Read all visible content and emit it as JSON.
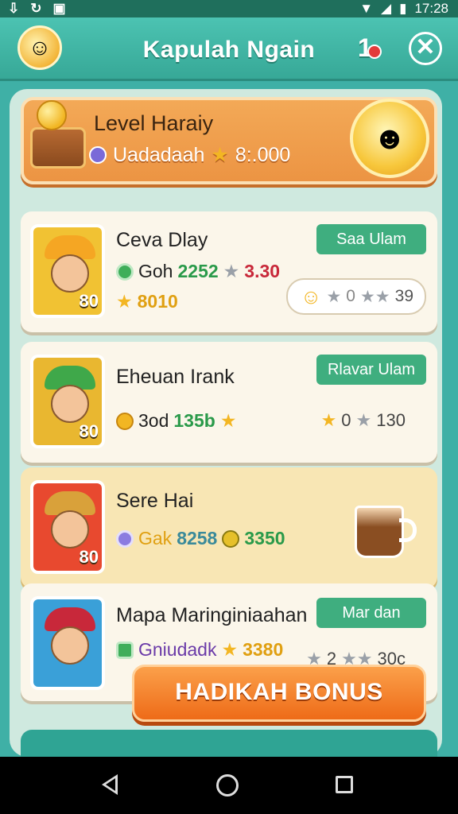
{
  "status_bar": {
    "time": "17:28",
    "left_icons": [
      "download-icon",
      "sync-icon",
      "image-icon"
    ],
    "right_icons": [
      "wifi-icon",
      "signal-icon",
      "battery-icon"
    ]
  },
  "header": {
    "title": "Kapulah Ngain",
    "notification_count": "1",
    "close_label": "✕"
  },
  "level_card": {
    "title": "Level Haraiy",
    "subtitle": "Uadadaah",
    "score": "8:.000"
  },
  "items": [
    {
      "title": "Ceva Dlay",
      "badge": "80",
      "stat1_label": "Goh",
      "stat1_value": "2252",
      "stat2_value": "3.30",
      "stat3_value": "8010",
      "button": "Saa Ulam",
      "rating": "39",
      "accent": "#3fae7f"
    },
    {
      "title": "Eheuan Irank",
      "badge": "80",
      "stat1_label": "3od",
      "stat1_value": "135b",
      "button": "Rlavar Ulam",
      "rating_left": "0",
      "rating": "130"
    },
    {
      "title": "Sere Hai",
      "badge": "80",
      "stat1_label": "Gak",
      "stat1_value": "8258",
      "stat2_value": "3350"
    },
    {
      "title": "Mapa Maringiniaahan",
      "stat1_label": "Gniudadk",
      "stat1_value": "3380",
      "button": "Mar dan",
      "rating_left": "2",
      "rating": "30c"
    }
  ],
  "bonus_button": "HADIKAH BONUS",
  "colors": {
    "teal": "#3fb0a6",
    "orange": "#ee6b18",
    "green_pill": "#3fae7f"
  }
}
